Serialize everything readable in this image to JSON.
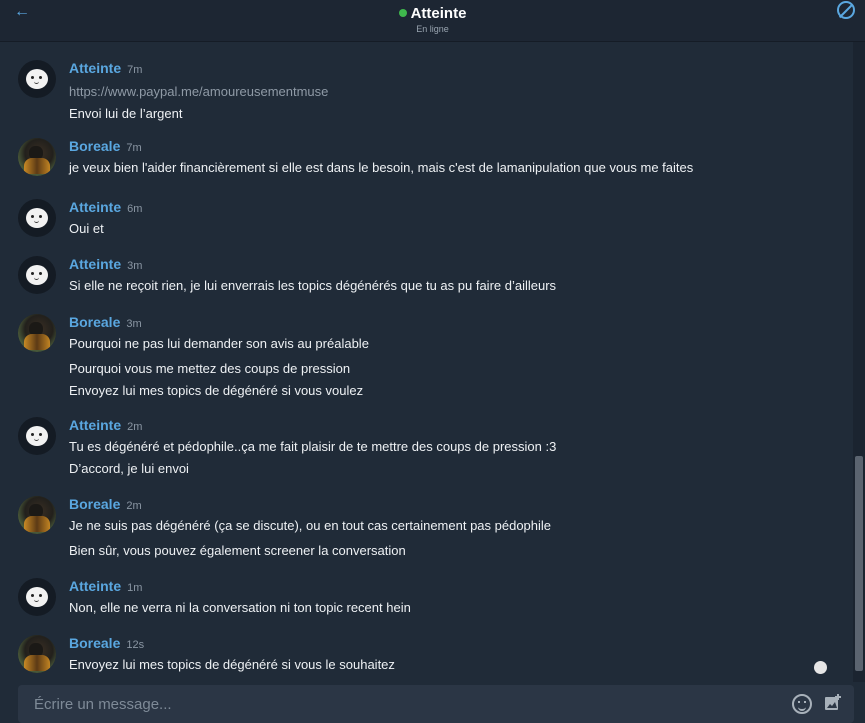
{
  "header": {
    "title": "Atteinte",
    "status": "En ligne",
    "colors": {
      "online": "#3fb84d",
      "accent": "#5aa7e0"
    }
  },
  "messages": [
    {
      "author": "Atteinte",
      "time": "7m",
      "avatar": "cartoon-avatar",
      "lines": [
        "https://www.paypal.me/amoureusementmuse",
        "Envoi lui de l’argent"
      ]
    },
    {
      "author": "Boreale",
      "time": "7m",
      "avatar": "photo-avatar",
      "lines": [
        "je veux bien l'aider financièrement si elle est dans le besoin, mais c'est de lamanipulation que vous me faites"
      ]
    },
    {
      "author": "Atteinte",
      "time": "6m",
      "avatar": "cartoon-avatar",
      "lines": [
        "Oui et"
      ]
    },
    {
      "author": "Atteinte",
      "time": "3m",
      "avatar": "cartoon-avatar",
      "lines": [
        "Si elle ne reçoit rien, je lui enverrais les topics dégénérés que tu as pu faire d’ailleurs"
      ]
    },
    {
      "author": "Boreale",
      "time": "3m",
      "avatar": "photo-avatar",
      "lines": [
        "Pourquoi ne pas lui demander son avis au préalable",
        "Pourquoi vous me mettez des coups de pression",
        "Envoyez lui mes topics de dégénéré si vous voulez"
      ]
    },
    {
      "author": "Atteinte",
      "time": "2m",
      "avatar": "cartoon-avatar",
      "lines": [
        "Tu es dégénéré et pédophile..ça me fait plaisir de te mettre des coups de pression :3",
        "D’accord, je lui envoi"
      ]
    },
    {
      "author": "Boreale",
      "time": "2m",
      "avatar": "photo-avatar",
      "lines": [
        "Je ne suis pas dégénéré (ça se discute), ou en tout cas certainement pas pédophile",
        "Bien sûr, vous pouvez également screener la conversation"
      ]
    },
    {
      "author": "Atteinte",
      "time": "1m",
      "avatar": "cartoon-avatar",
      "lines": [
        "Non, elle ne verra ni la conversation ni ton topic recent hein"
      ]
    },
    {
      "author": "Boreale",
      "time": "12s",
      "avatar": "photo-avatar",
      "lines": [
        "Envoyez lui mes topics de dégénéré si vous le souhaitez"
      ]
    }
  ],
  "composer": {
    "placeholder": "Écrire un message...",
    "icons": [
      "emoji-icon",
      "image-add-icon"
    ]
  }
}
